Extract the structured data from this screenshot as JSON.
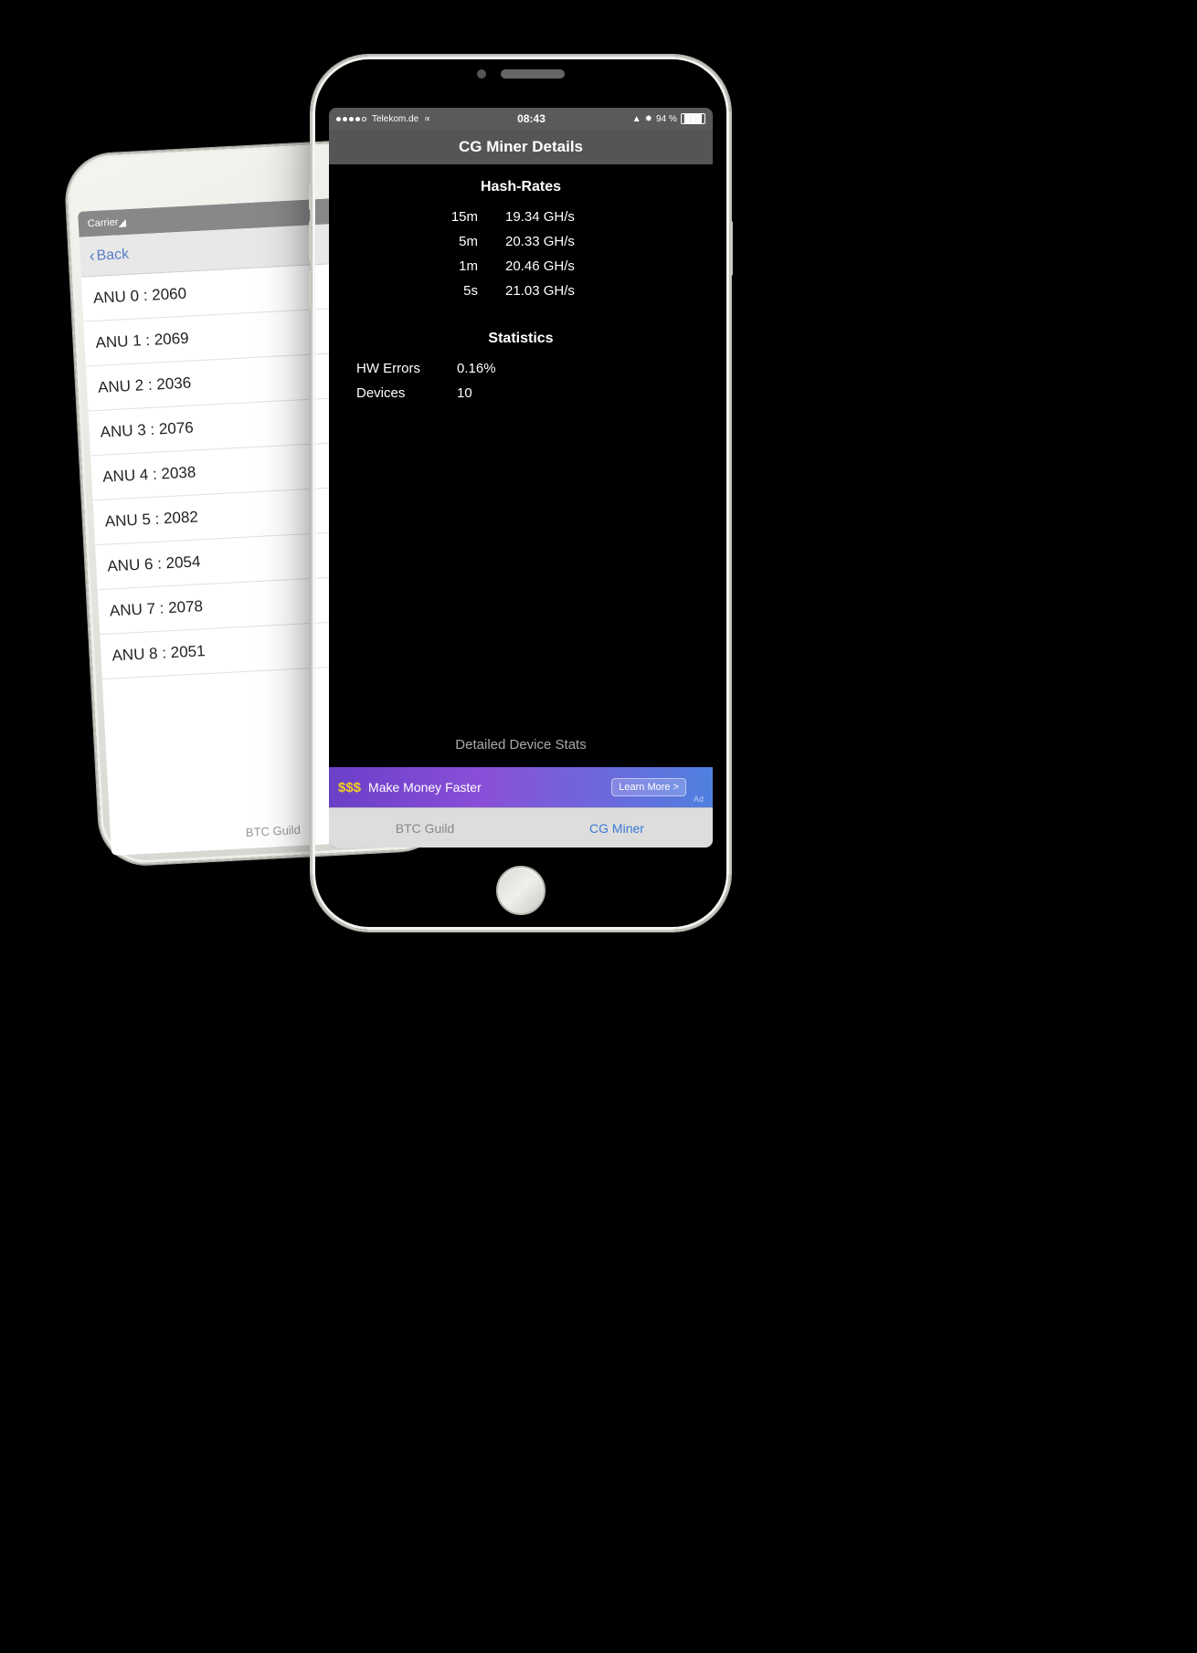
{
  "bg_phone": {
    "statusbar": {
      "carrier": "Carrier",
      "wifi_icon": "▾"
    },
    "navbar": {
      "back_label": "Back"
    },
    "list_items": [
      "ANU 0 : 2060",
      "ANU 1 : 2069",
      "ANU 2 : 2036",
      "ANU 3 : 2076",
      "ANU 4 : 2038",
      "ANU 5 : 2082",
      "ANU 6 : 2054",
      "ANU 7 : 2078",
      "ANU 8 : 2051"
    ],
    "footer": "BTC Guild"
  },
  "fg_phone": {
    "statusbar": {
      "carrier": "●●●●○ Telekom.de",
      "wifi": "▾",
      "time": "08:43",
      "gps_icon": "▲",
      "battery_pct": "94 %"
    },
    "navbar": {
      "title": "CG Miner Details"
    },
    "hash_rates": {
      "section_title": "Hash-Rates",
      "rows": [
        {
          "label": "15m",
          "value": "19.34 GH/s"
        },
        {
          "label": "5m",
          "value": "20.33 GH/s"
        },
        {
          "label": "1m",
          "value": "20.46 GH/s"
        },
        {
          "label": "5s",
          "value": "21.03 GH/s"
        }
      ]
    },
    "statistics": {
      "section_title": "Statistics",
      "rows": [
        {
          "label": "HW Errors",
          "value": "0.16%"
        },
        {
          "label": "Devices",
          "value": "10"
        }
      ]
    },
    "detail_device_stats": "Detailed Device Stats",
    "ad": {
      "money_icon": "$$$",
      "text": "Make Money Faster",
      "learn_more": "Learn More >",
      "ad_label": "Ad"
    },
    "tabbar": {
      "tabs": [
        {
          "label": "BTC Guild",
          "active": false
        },
        {
          "label": "CG Miner",
          "active": true
        }
      ]
    }
  }
}
